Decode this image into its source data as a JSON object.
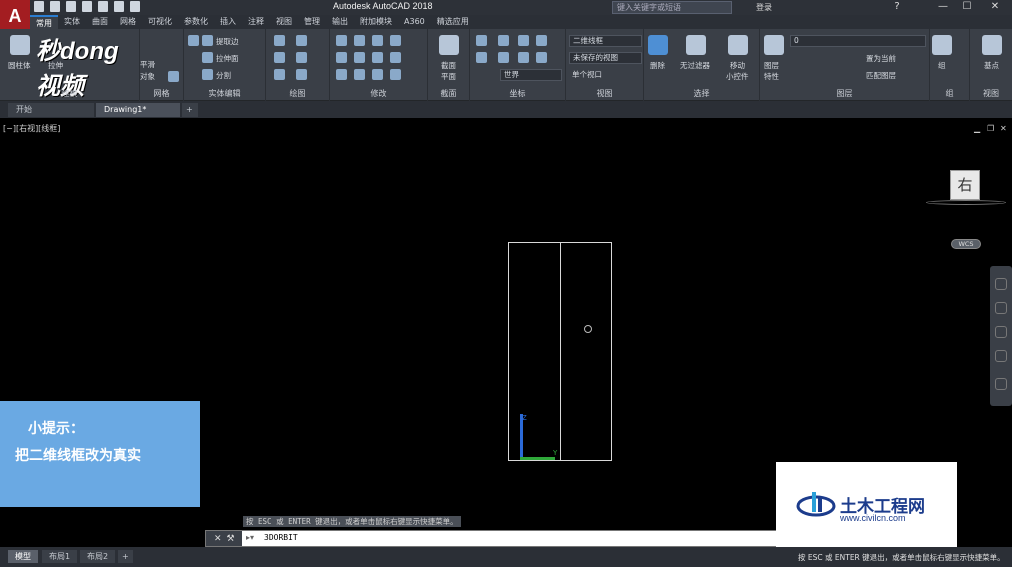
{
  "titlebar": {
    "logo": "A",
    "title": "Autodesk AutoCAD 2018",
    "search_placeholder": "键入关键字或短语",
    "login": "登录",
    "help": "?"
  },
  "ribbon_tabs": [
    "常用",
    "实体",
    "曲面",
    "网格",
    "可视化",
    "参数化",
    "插入",
    "注释",
    "视图",
    "管理",
    "输出",
    "附加模块",
    "A360",
    "精选应用"
  ],
  "ribbon": {
    "brand": "秒dong视频",
    "modeling": {
      "cylinder": "圆柱体",
      "extrude": "拉伸",
      "smooth": "平滑",
      "object": "对象",
      "title": "建模"
    },
    "mesh": {
      "title": "网格"
    },
    "solid_edit": {
      "extract_edges": "提取边",
      "extrude_face": "拉伸面",
      "separate": "分割",
      "title": "实体编辑"
    },
    "draw": {
      "title": "绘图"
    },
    "modify": {
      "title": "修改"
    },
    "section": {
      "plane": "截面",
      "plane2": "平面",
      "title": "截面"
    },
    "coords": {
      "title": "坐标",
      "world": "世界"
    },
    "view": {
      "style": "二维线框",
      "saved_view": "未保存的视图",
      "single_viewport": "单个视口",
      "title": "视图"
    },
    "selection": {
      "delete": "删除",
      "no_filter": "无过滤器",
      "move": "移动",
      "gizmo": "小控件",
      "title": "选择"
    },
    "layers": {
      "properties": "图层",
      "properties2": "特性",
      "current_layer": "0",
      "set_current": "置为当前",
      "match_layer": "匹配图层",
      "title": "图层"
    },
    "group": {
      "label": "组",
      "title": "组"
    },
    "base": {
      "label": "基点"
    },
    "view2": {
      "title": "视图"
    }
  },
  "file_tabs": [
    "开始",
    "Drawing1*"
  ],
  "viewport": {
    "label": "[−][右视][线框]",
    "viewcube_face": "右",
    "wcs": "WCS",
    "axis_z": "Z",
    "axis_y": "Y"
  },
  "tip": {
    "title": "小提示：",
    "body": "把二维线框改为真实"
  },
  "watermark": {
    "name": "土木工程网",
    "url": "www.civilcn.com"
  },
  "command": {
    "hint": "按 ESC 或 ENTER 键退出，或者单击鼠标右键显示快捷菜单。",
    "text": "3DORBIT"
  },
  "status": {
    "tabs": [
      "模型",
      "布局1",
      "布局2"
    ],
    "message": "按 ESC 或 ENTER 键退出，或者单击鼠标右键显示快捷菜单。"
  }
}
